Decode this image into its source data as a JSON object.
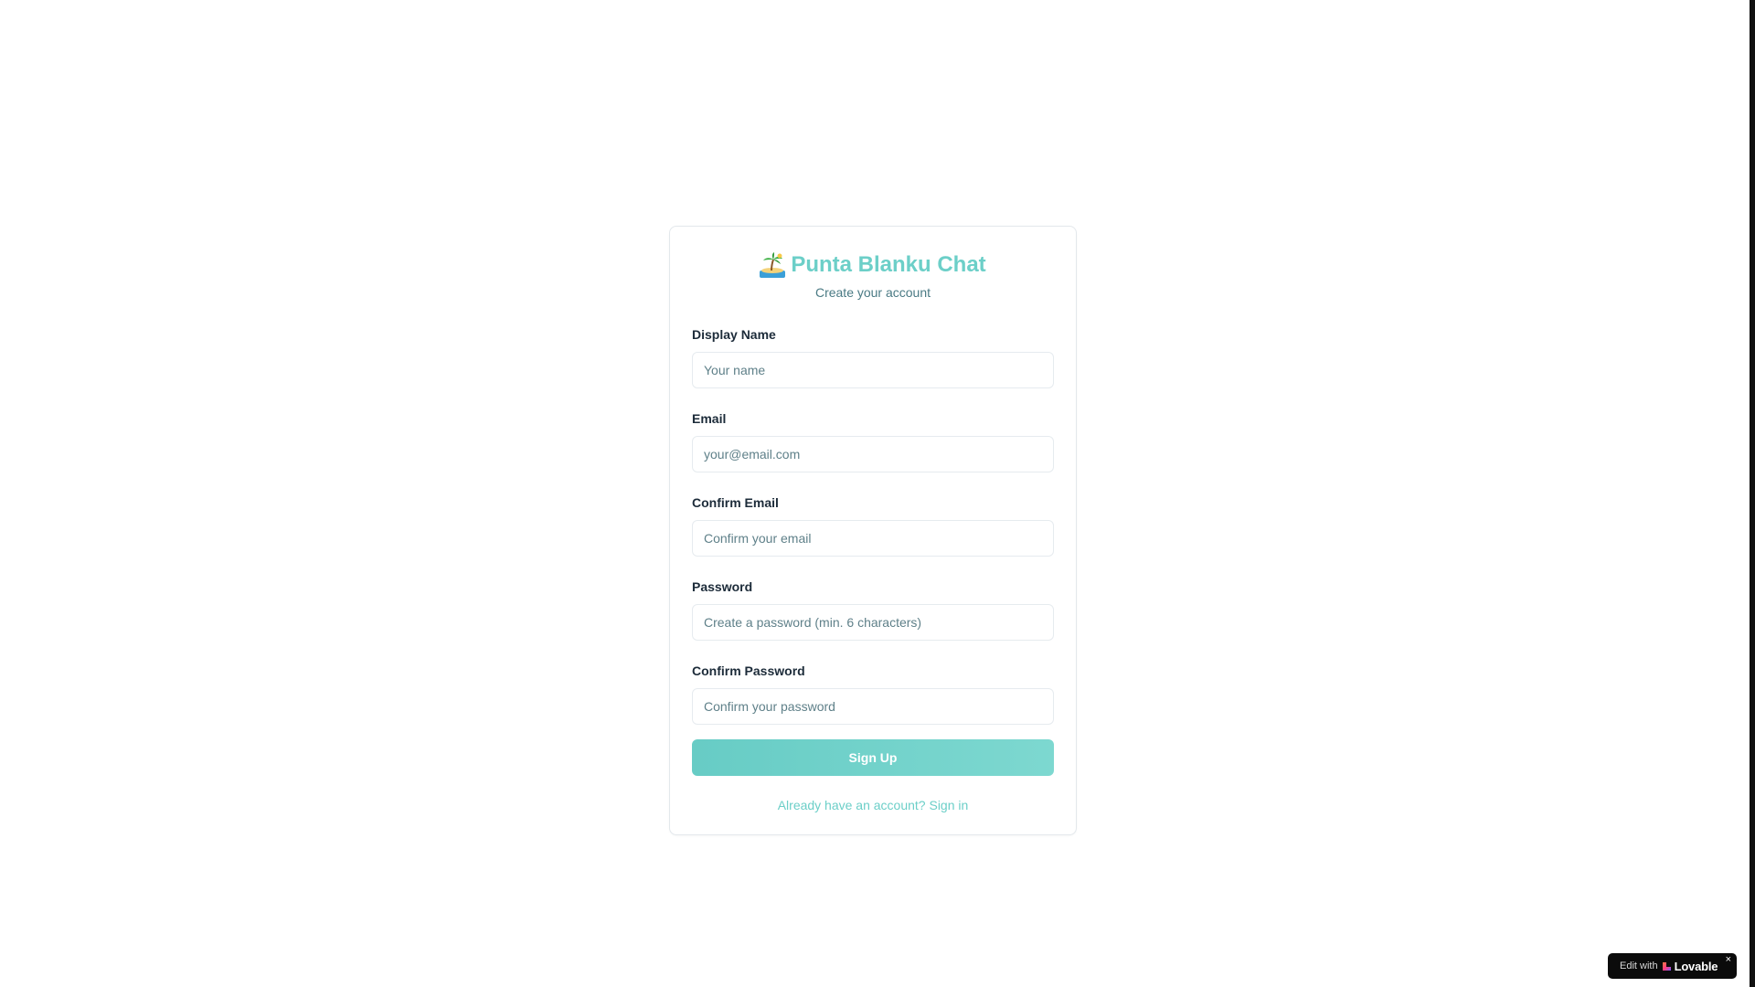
{
  "brand": {
    "title": "Punta Blanku Chat",
    "icon": "desert-island-icon",
    "subtitle": "Create your account",
    "accent_color": "#6ccfc8"
  },
  "form": {
    "fields": [
      {
        "label": "Display Name",
        "placeholder": "Your name",
        "value": ""
      },
      {
        "label": "Email",
        "placeholder": "your@email.com",
        "value": ""
      },
      {
        "label": "Confirm Email",
        "placeholder": "Confirm your email",
        "value": ""
      },
      {
        "label": "Password",
        "placeholder": "Create a password (min. 6 characters)",
        "value": ""
      },
      {
        "label": "Confirm Password",
        "placeholder": "Confirm your password",
        "value": ""
      }
    ],
    "submit_label": "Sign Up",
    "signin_link": "Already have an account? Sign in"
  },
  "badge": {
    "prefix": "Edit with",
    "brand": "Lovable",
    "icon": "lovable-heart-icon",
    "close": "×"
  }
}
